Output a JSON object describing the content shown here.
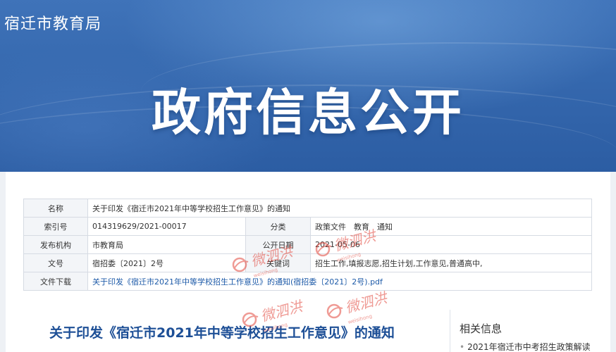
{
  "header": {
    "site_name": "宿迁市教育局",
    "banner_title": "政府信息公开"
  },
  "meta": {
    "name_label": "名称",
    "name_value": "关于印发《宿迁市2021年中等学校招生工作意见》的通知",
    "index_label": "索引号",
    "index_value": "014319629/2021-00017",
    "category_label": "分类",
    "category_value": "政策文件　教育　通知",
    "publisher_label": "发布机构",
    "publisher_value": "市教育局",
    "date_label": "公开日期",
    "date_value": "2021-05-06",
    "docno_label": "文号",
    "docno_value": "宿招委〔2021〕2号",
    "keywords_label": "关键词",
    "keywords_value": "招生工作,填报志愿,招生计划,工作意见,普通高中,",
    "download_label": "文件下载",
    "download_link": "关于印发《宿迁市2021年中等学校招生工作意见》的通知(宿招委〔2021〕2号).pdf"
  },
  "article": {
    "title": "关于印发《宿迁市2021年中等学校招生工作意见》的通知"
  },
  "sidebar": {
    "heading": "相关信息",
    "items": [
      {
        "label": "2021年宿迁市中考招生政策解读"
      }
    ]
  },
  "watermark": {
    "text": "微泗洪",
    "subtext": "weisihong",
    "color": "#e2483d"
  }
}
